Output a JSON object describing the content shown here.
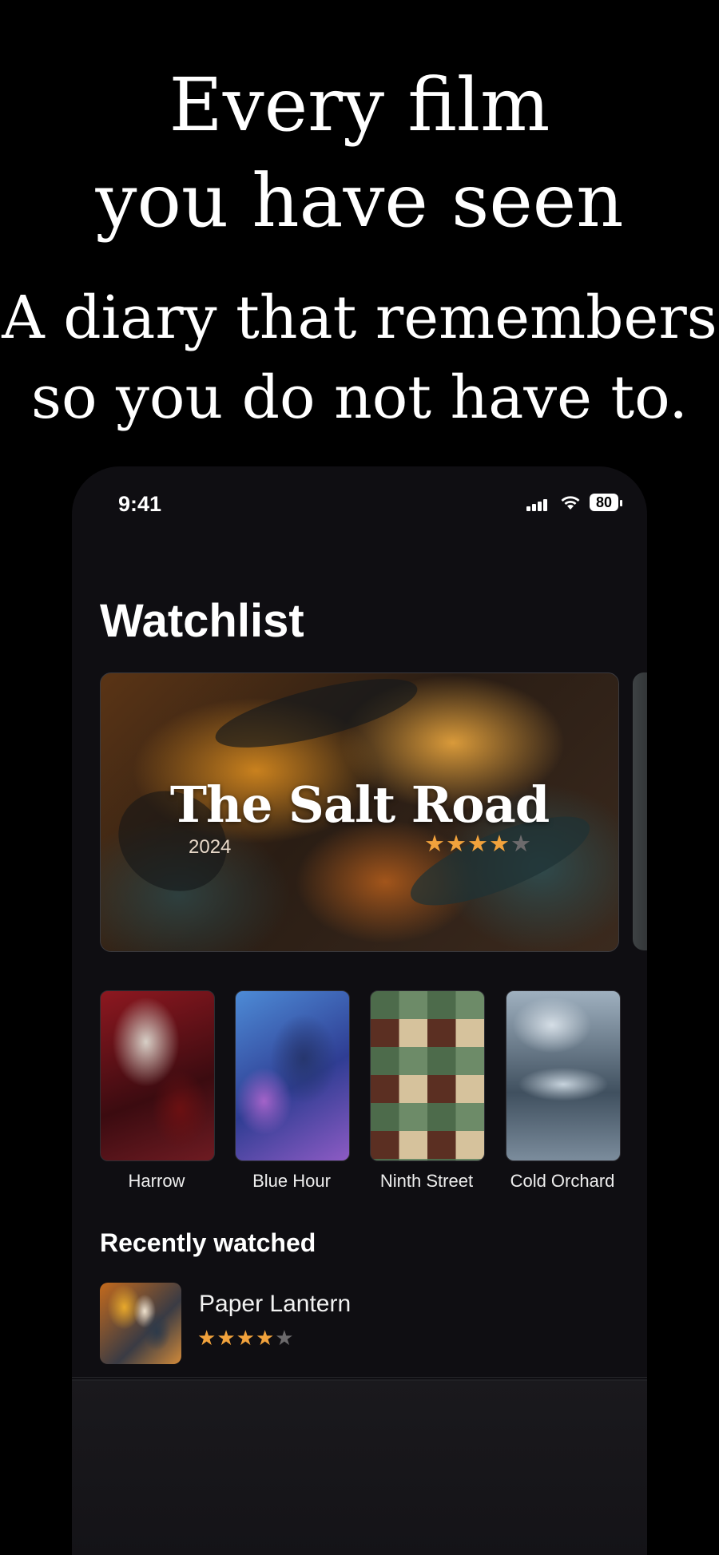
{
  "marketing": {
    "headline_line1": "Every film",
    "headline_line2": "you have seen",
    "sub_line1": "A diary that remembers",
    "sub_line2": "so you do not have to."
  },
  "status_bar": {
    "time": "9:41",
    "battery": "80"
  },
  "page": {
    "title": "Watchlist"
  },
  "featured": {
    "title": "The Salt Road",
    "year": "2024",
    "rating": 4,
    "rating_max": 5
  },
  "posters": [
    {
      "title": "Harrow"
    },
    {
      "title": "Blue Hour"
    },
    {
      "title": "Ninth Street"
    },
    {
      "title": "Cold Orchard"
    }
  ],
  "recently_watched": {
    "heading": "Recently watched",
    "items": [
      {
        "title": "Paper Lantern",
        "rating": 4,
        "rating_max": 5
      }
    ]
  },
  "colors": {
    "star_active": "#f1a23c",
    "star_inactive": "#6c6a6c",
    "screen_bg": "#0f0e12"
  }
}
